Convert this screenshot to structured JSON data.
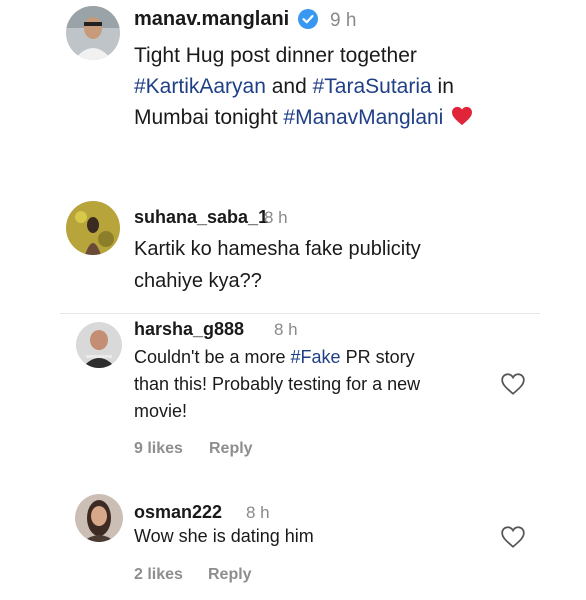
{
  "post": {
    "username": "manav.manglani",
    "time": "9 h",
    "verified_icon": "verified-badge-icon",
    "line1": "Tight Hug post dinner together",
    "tag1": "#KartikAaryan",
    "and": " and ",
    "tag2": "#TaraSutaria",
    "in": " in",
    "line3_prefix": "Mumbai tonight ",
    "tag3": "#ManavManglani",
    "heart_emoji": "❤️"
  },
  "comments": [
    {
      "username": "suhana_saba_1",
      "time": "8 h",
      "line1": "Kartik ko hamesha fake publicity",
      "line2": "chahiye kya??"
    },
    {
      "username": "harsha_g888",
      "time": "8 h",
      "line1_prefix": "Couldn't be a more ",
      "tag": "#Fake",
      "line1_suffix": " PR story",
      "line2": "than this! Probably testing for a new",
      "line3": "movie!",
      "likes": "9 likes",
      "reply": "Reply"
    },
    {
      "username": "osman222",
      "time": "8 h",
      "line1": "Wow she is dating him",
      "likes": "2 likes",
      "reply": "Reply"
    }
  ],
  "colors": {
    "hashtag": "#1f3f86",
    "verified": "#3897f0",
    "muted": "#8e8e8e"
  }
}
